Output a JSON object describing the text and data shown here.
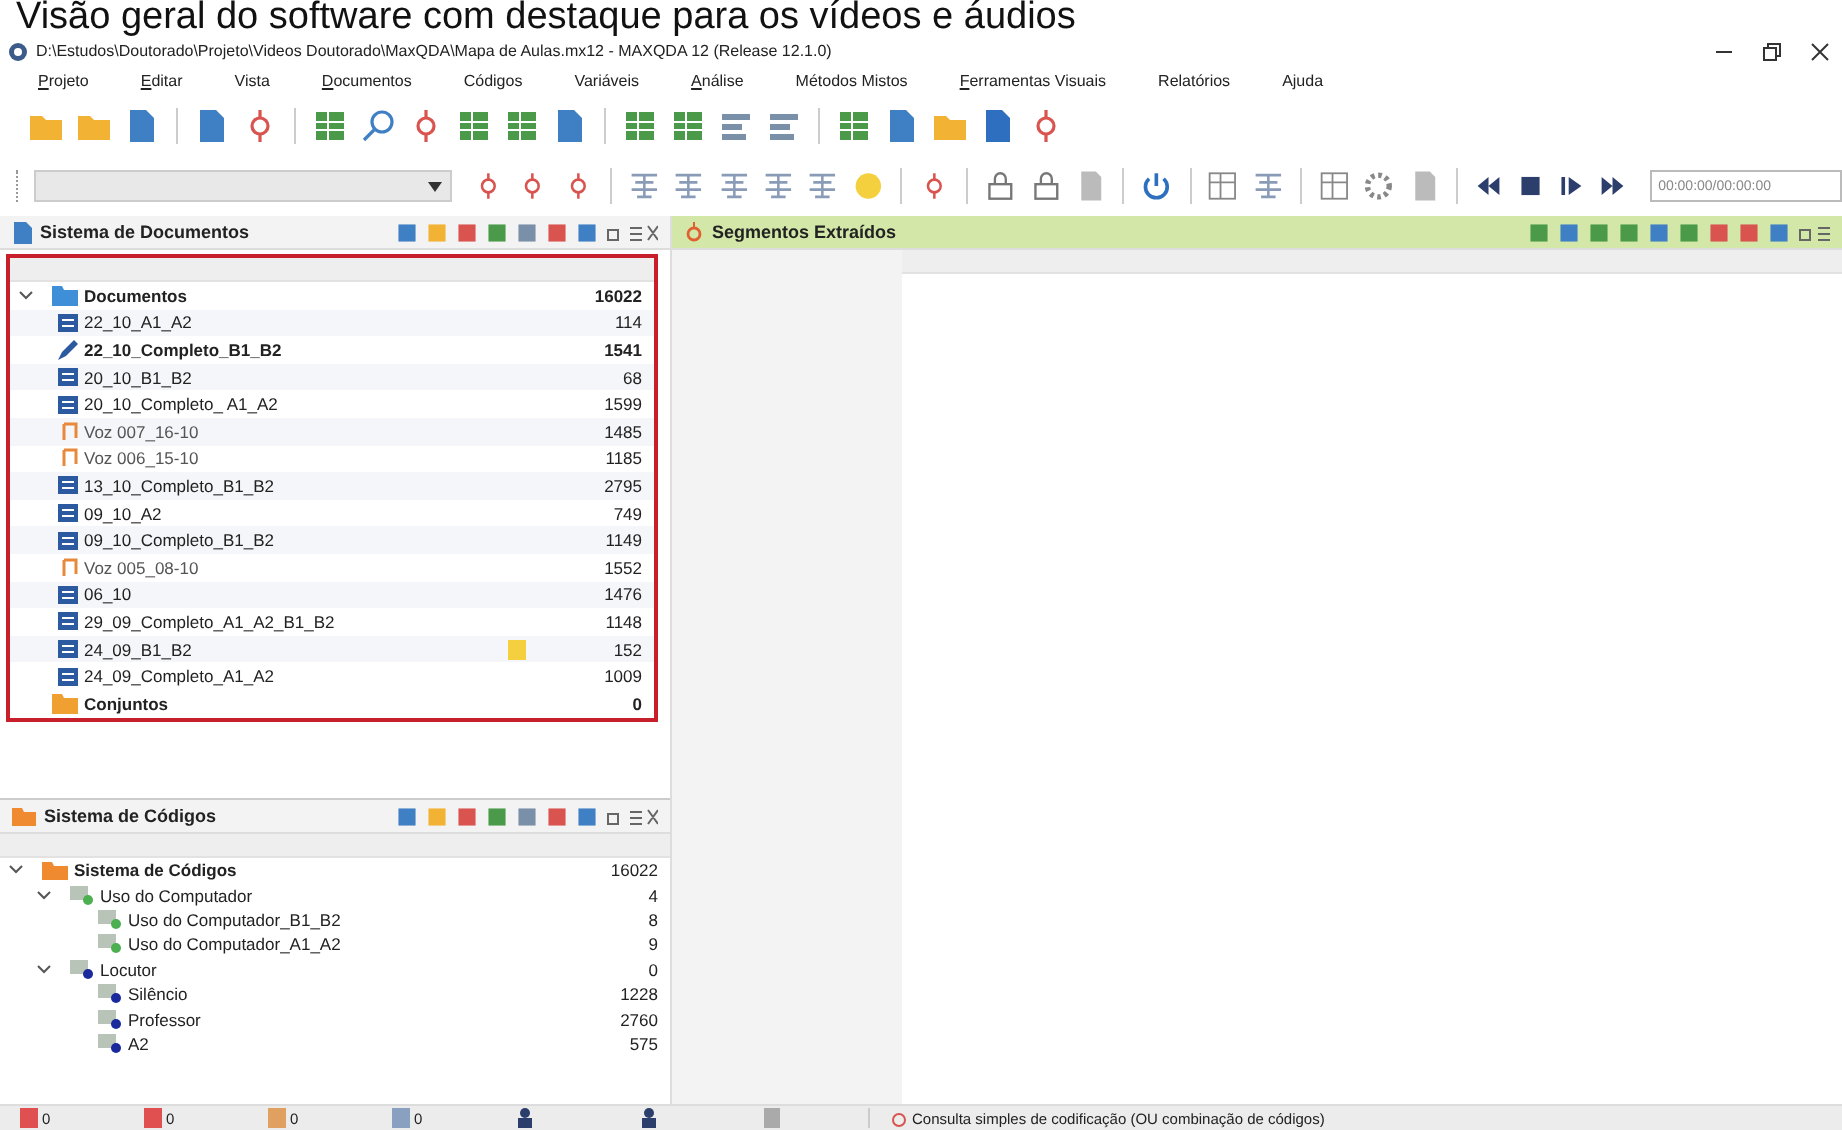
{
  "caption": "Visão geral do software com destaque para os vídeos e áudios",
  "window": {
    "title": "D:\\Estudos\\Doutorado\\Projeto\\Videos Doutorado\\MaxQDA\\Mapa de Aulas.mx12 - MAXQDA 12  (Release 12.1.0)"
  },
  "menu": [
    {
      "label": "Projeto",
      "underlined": true
    },
    {
      "label": "Editar",
      "underlined": true
    },
    {
      "label": "Vista",
      "underlined": false
    },
    {
      "label": "Documentos",
      "underlined": true
    },
    {
      "label": "Códigos",
      "underlined": false
    },
    {
      "label": "Variáveis",
      "underlined": false
    },
    {
      "label": "Análise",
      "underlined": true
    },
    {
      "label": "Métodos Mistos",
      "underlined": false
    },
    {
      "label": "Ferramentas Visuais",
      "underlined": true
    },
    {
      "label": "Relatórios",
      "underlined": false
    },
    {
      "label": "Ajuda",
      "underlined": false
    }
  ],
  "media": {
    "time": "00:00:00/00:00:00"
  },
  "documents_panel": {
    "title": "Sistema de Documentos",
    "root": {
      "name": "Documentos",
      "count": "16022",
      "expanded": true,
      "children": [
        {
          "name": "22_10_A1_A2",
          "count": "114",
          "kind": "text",
          "memo": false
        },
        {
          "name": "22_10_Completo_B1_B2",
          "count": "1541",
          "kind": "edited",
          "memo": false
        },
        {
          "name": "20_10_B1_B2",
          "count": "68",
          "kind": "text",
          "memo": false
        },
        {
          "name": "20_10_Completo_ A1_A2",
          "count": "1599",
          "kind": "text",
          "memo": false
        },
        {
          "name": "Voz 007_16-10",
          "count": "1485",
          "kind": "audio",
          "memo": false
        },
        {
          "name": "Voz 006_15-10",
          "count": "1185",
          "kind": "audio",
          "memo": false
        },
        {
          "name": "13_10_Completo_B1_B2",
          "count": "2795",
          "kind": "text",
          "memo": false
        },
        {
          "name": "09_10_A2",
          "count": "749",
          "kind": "text",
          "memo": false
        },
        {
          "name": "09_10_Completo_B1_B2",
          "count": "1149",
          "kind": "text",
          "memo": false
        },
        {
          "name": "Voz 005_08-10",
          "count": "1552",
          "kind": "audio",
          "memo": false
        },
        {
          "name": "06_10",
          "count": "1476",
          "kind": "text",
          "memo": false
        },
        {
          "name": "29_09_Completo_A1_A2_B1_B2",
          "count": "1148",
          "kind": "text",
          "memo": false
        },
        {
          "name": "24_09_B1_B2",
          "count": "152",
          "kind": "text",
          "memo": true
        },
        {
          "name": "24_09_Completo_A1_A2",
          "count": "1009",
          "kind": "text",
          "memo": false
        }
      ]
    },
    "sets": {
      "name": "Conjuntos",
      "count": "0"
    }
  },
  "segments_panel": {
    "title": "Segmentos Extraídos"
  },
  "codes_panel": {
    "title": "Sistema de Códigos",
    "root": {
      "name": "Sistema de Códigos",
      "count": "16022",
      "expanded": true,
      "children": [
        {
          "name": "Uso do Computador",
          "count": "4",
          "color": "#4caf50",
          "expanded": true,
          "children": [
            {
              "name": "Uso do Computador_B1_B2",
              "count": "8",
              "color": "#4caf50"
            },
            {
              "name": "Uso do Computador_A1_A2",
              "count": "9",
              "color": "#4caf50"
            }
          ]
        },
        {
          "name": "Locutor",
          "count": "0",
          "color": "#1a2a9c",
          "expanded": true,
          "children": [
            {
              "name": "Silêncio",
              "count": "1228",
              "color": "#1a2a9c"
            },
            {
              "name": "Professor",
              "count": "2760",
              "color": "#1a2a9c"
            },
            {
              "name": "A2",
              "count": "575",
              "color": "#1a2a9c"
            }
          ]
        }
      ]
    }
  },
  "status_bar": {
    "counters": [
      "0",
      "0",
      "0",
      "0"
    ],
    "message": "Consulta simples de codificação (OU combinação de códigos)"
  }
}
